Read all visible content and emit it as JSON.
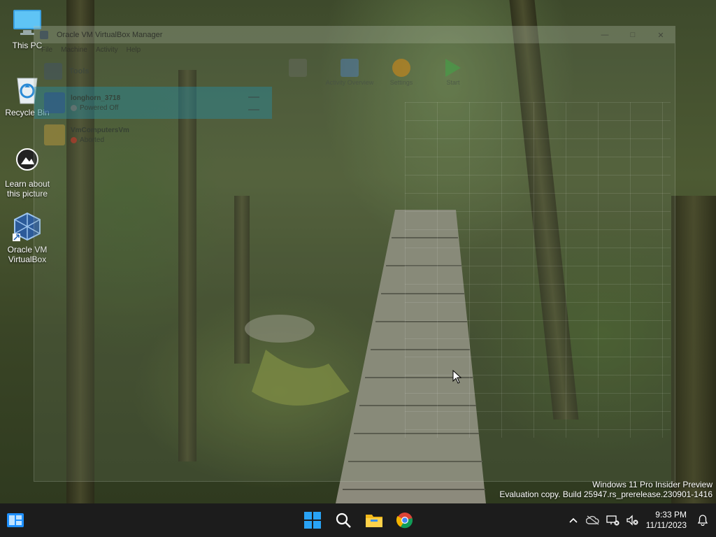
{
  "desktop": {
    "icons": [
      {
        "label": "This PC"
      },
      {
        "label": "Recycle Bin"
      },
      {
        "label": "Learn about this picture"
      },
      {
        "label": "Oracle VM VirtualBox"
      }
    ]
  },
  "vbox": {
    "title": "Oracle VM VirtualBox Manager",
    "menu": [
      "File",
      "Machine",
      "Activity",
      "Help"
    ],
    "tools_label": "Tools",
    "toolbar": [
      {
        "label": "",
        "icon": "preview-icon"
      },
      {
        "label": "Activity Overview",
        "icon": "activity-overview-icon"
      },
      {
        "label": "Settings",
        "icon": "gear-icon"
      },
      {
        "label": "Start",
        "icon": "start-arrow-icon"
      }
    ],
    "vms": [
      {
        "name": "longhorn_3718",
        "state": "Powered Off",
        "state_color": "#7a7a7a",
        "selected": true
      },
      {
        "name": "VmComputersVm",
        "state": "Aborted",
        "state_color": "#c0392b",
        "selected": false
      }
    ]
  },
  "watermark": {
    "line1": "Windows 11 Pro Insider Preview",
    "line2": "Evaluation copy. Build 25947.rs_prerelease.230901-1416"
  },
  "taskbar": {
    "time": "9:33 PM",
    "date": "11/11/2023",
    "accent": "#0a84ff"
  }
}
